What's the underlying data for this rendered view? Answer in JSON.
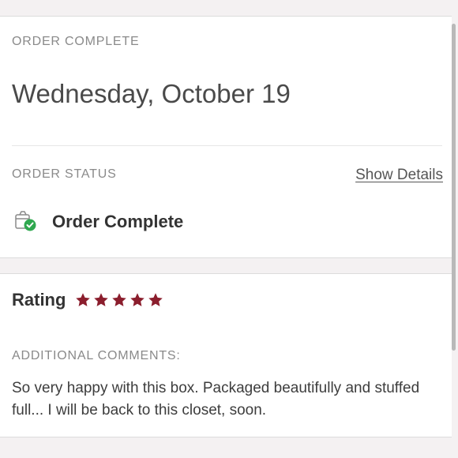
{
  "order": {
    "heading": "ORDER COMPLETE",
    "date": "Wednesday, October 19"
  },
  "status": {
    "heading": "ORDER STATUS",
    "show_details_label": "Show Details",
    "text": "Order Complete",
    "icon": "package-complete-icon"
  },
  "rating": {
    "label": "Rating",
    "stars": 5,
    "max_stars": 5,
    "star_color": "#8b1e2d"
  },
  "comments": {
    "heading": "ADDITIONAL COMMENTS:",
    "text": "So very happy with this box. Packaged beautifully and stuffed full... I will be back to this closet, soon."
  },
  "colors": {
    "accent": "#8b1e2d",
    "check": "#2fa84f"
  }
}
